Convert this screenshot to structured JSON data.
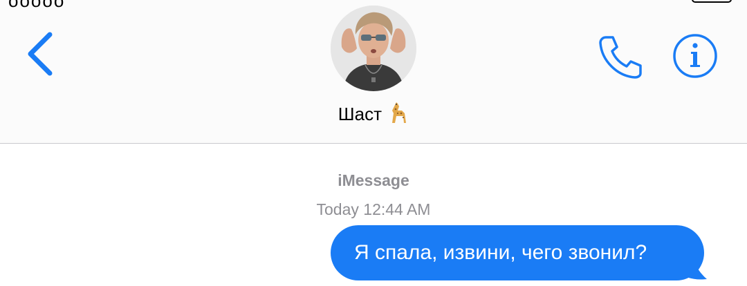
{
  "header": {
    "contact_name": "Шаст",
    "contact_emoji": "giraffe",
    "back_icon": "chevron-left-icon",
    "call_icon": "phone-icon",
    "info_icon": "info-icon",
    "accent_color": "#1a7cf5"
  },
  "conversation": {
    "service_label": "iMessage",
    "timestamp": "Today 12:44 AM",
    "messages": [
      {
        "direction": "outgoing",
        "text": "Я спала, извини, чего звонил?",
        "bubble_color": "#1a7cf5"
      }
    ]
  }
}
